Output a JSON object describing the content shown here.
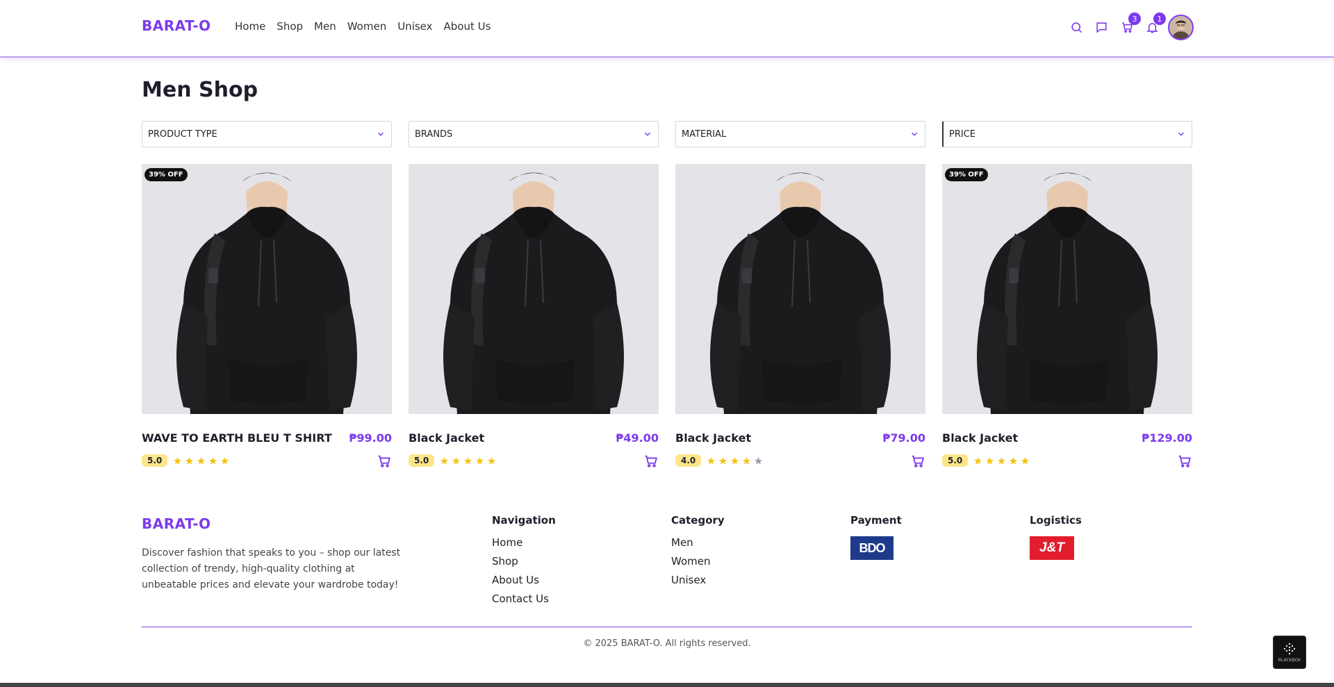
{
  "header": {
    "brand": "BARAT-O",
    "nav": [
      "Home",
      "Shop",
      "Men",
      "Women",
      "Unisex",
      "About Us"
    ],
    "cart_count": "3",
    "notification_count": "1"
  },
  "main": {
    "title": "Men Shop",
    "filters": [
      "PRODUCT TYPE",
      "BRANDS",
      "MATERIAL",
      "PRICE"
    ],
    "products": [
      {
        "name": "WAVE TO EARTH BLEU T SHIRT",
        "price": "₱99.00",
        "rating": "5.0",
        "stars": 5,
        "discount": "39% OFF"
      },
      {
        "name": "Black Jacket",
        "price": "₱49.00",
        "rating": "5.0",
        "stars": 5,
        "discount": ""
      },
      {
        "name": "Black Jacket",
        "price": "₱79.00",
        "rating": "4.0",
        "stars": 4,
        "discount": ""
      },
      {
        "name": "Black Jacket",
        "price": "₱129.00",
        "rating": "5.0",
        "stars": 5,
        "discount": "39% OFF"
      }
    ]
  },
  "footer": {
    "brand": "BARAT-O",
    "description": "Discover fashion that speaks to you – shop our latest collection of trendy, high-quality clothing at unbeatable prices and elevate your wardrobe today!",
    "navigation": {
      "title": "Navigation",
      "links": [
        "Home",
        "Shop",
        "About Us",
        "Contact Us"
      ]
    },
    "category": {
      "title": "Category",
      "links": [
        "Men",
        "Women",
        "Unisex"
      ]
    },
    "payment": {
      "title": "Payment",
      "logo_text": "BDO"
    },
    "logistics": {
      "title": "Logistics",
      "logo_text": "J&T"
    },
    "copyright": "© 2025 BARAT-O. All rights reserved.",
    "widget_label": "BLACKBOX"
  },
  "colors": {
    "accent": "#7c3aed",
    "star": "#f5c518",
    "star_empty": "#9ca3af",
    "rating_bg": "#fde68a"
  }
}
